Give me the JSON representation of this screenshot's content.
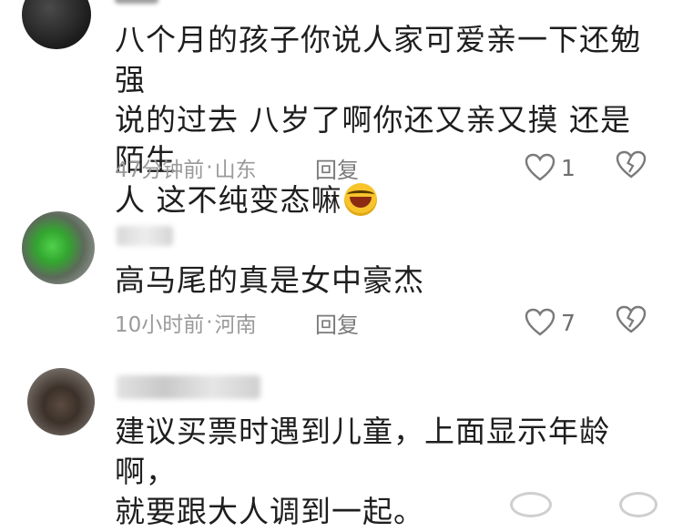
{
  "comments": [
    {
      "text_lines": [
        "八个月的孩子你说人家可爱亲一下还勉强",
        "说的过去  八岁了啊你还又亲又摸  还是陌生",
        "人  这不纯变态嘛"
      ],
      "emoji_icon": "laughing-crying-emoji-icon",
      "time": "47分钟前",
      "dot": "·",
      "location": "山东",
      "reply_label": "回复",
      "likes": "1"
    },
    {
      "text_lines": [
        "高马尾的真是女中豪杰"
      ],
      "time": "10小时前",
      "dot": "·",
      "location": "河南",
      "reply_label": "回复",
      "likes": "7"
    },
    {
      "text_lines": [
        "建议买票时遇到儿童，上面显示年龄啊，",
        "就要跟大人调到一起。"
      ]
    }
  ],
  "colors": {
    "text": "#1e1e1e",
    "meta": "#9a9a9a",
    "icon_stroke": "#7a7a7a"
  }
}
